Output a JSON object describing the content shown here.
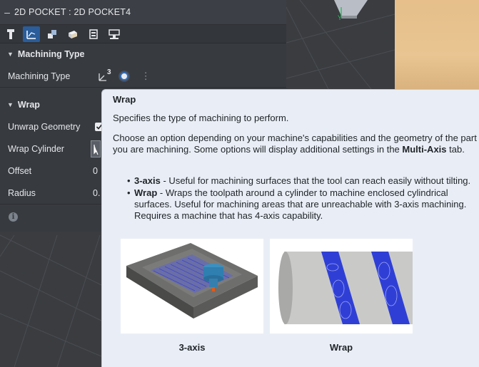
{
  "panel": {
    "title": "2D POCKET : 2D POCKET4",
    "collapse_glyph": "–",
    "tabs": [
      {
        "icon": "tool-icon",
        "active": false
      },
      {
        "icon": "geometry-icon",
        "active": true
      },
      {
        "icon": "heights-icon",
        "active": false
      },
      {
        "icon": "passes-icon",
        "active": false
      },
      {
        "icon": "linking-icon",
        "active": false
      },
      {
        "icon": "multi-axis-icon",
        "active": false
      }
    ],
    "machining_type_section": {
      "header": "Machining Type",
      "row_label": "Machining Type",
      "option_badge": "3"
    },
    "wrap_section": {
      "header": "Wrap",
      "rows": [
        {
          "label": "Unwrap Geometry",
          "value": ""
        },
        {
          "label": "Wrap Cylinder",
          "value": ""
        },
        {
          "label": "Offset",
          "value": "0"
        },
        {
          "label": "Radius",
          "value": "0."
        }
      ]
    }
  },
  "tooltip": {
    "title": "Wrap",
    "p1": "Specifies the type of machining to perform.",
    "p2_pre": "Choose an option depending on your machine's capabilities and the geometry of the part you are machining. Some options will display additional settings in the ",
    "p2_bold": "Multi-Axis",
    "p2_post": " tab.",
    "bullets": [
      {
        "term": "3-axis",
        "text": " - Useful for machining surfaces that the tool can reach easily without tilting."
      },
      {
        "term": "Wrap",
        "text": " - Wraps the toolpath around a cylinder to machine enclosed cylindrical surfaces. Useful for machining areas that are unreachable with 3-axis machining. Requires a machine that has 4-axis capability."
      }
    ],
    "captions": [
      "3-axis",
      "Wrap"
    ]
  },
  "colors": {
    "panel_bg": "#373a3f",
    "accent": "#2a5d9a",
    "tooltip_bg": "#e9eef6",
    "toolpath_blue": "#2f3fd6"
  }
}
